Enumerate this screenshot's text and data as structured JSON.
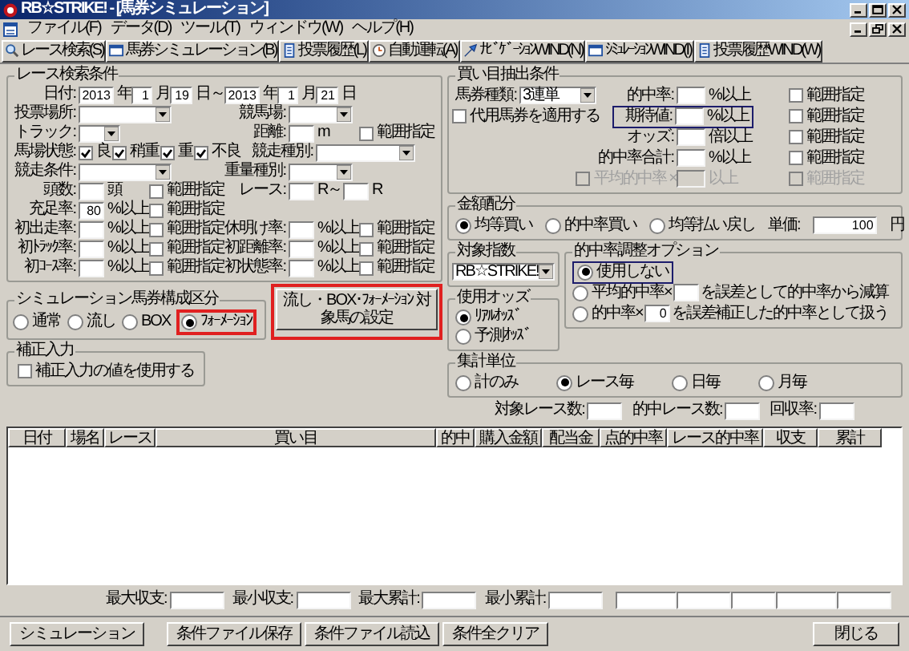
{
  "window": {
    "title": "RB☆STRIKE! - [馬券シミュレーション]"
  },
  "menu": [
    "ファイル(F)",
    "データ(D)",
    "ツール(T)",
    "ウィンドウ(W)",
    "ヘルプ(H)"
  ],
  "toolbar": [
    "レース検索(S)",
    "馬券シミュレーション(B)",
    "投票履歴(L)",
    "自動運転(A)",
    "ﾅﾋﾞｹﾞｰｼｮﾝWIND(N)",
    "ｼﾐｭﾚｰｼｮﾝWIND(I)",
    "投票履歴WIND(W)"
  ],
  "race_search": {
    "title": "レース検索条件",
    "lines": [
      {
        "items": [
          {
            "kind": "label",
            "text": "日付:"
          },
          {
            "kind": "field",
            "value": "2013"
          },
          {
            "kind": "unit",
            "text": "年"
          },
          {
            "kind": "field",
            "value": "1"
          },
          {
            "kind": "unit",
            "text": "月"
          },
          {
            "kind": "field",
            "value": "19"
          },
          {
            "kind": "unit",
            "text": "日～"
          },
          {
            "kind": "field",
            "value": "2013"
          },
          {
            "kind": "unit",
            "text": "年"
          },
          {
            "kind": "field",
            "value": "1"
          },
          {
            "kind": "unit",
            "text": "月"
          },
          {
            "kind": "field",
            "value": "21"
          },
          {
            "kind": "unit",
            "text": "日"
          }
        ]
      },
      {
        "items": [
          {
            "kind": "label",
            "text": "投票場所:"
          },
          {
            "kind": "dropdown"
          },
          {
            "kind": "label",
            "text": "競馬場:"
          },
          {
            "kind": "dropdown"
          }
        ]
      },
      {
        "items": [
          {
            "kind": "label",
            "text": "トラック:"
          },
          {
            "kind": "dropdown"
          },
          {
            "kind": "label",
            "text": "距離:"
          },
          {
            "kind": "field"
          },
          {
            "kind": "unit",
            "text": "m"
          },
          {
            "kind": "check",
            "text": "範囲指定",
            "checked": false
          }
        ]
      },
      {
        "items": [
          {
            "kind": "label",
            "text": "馬場状態:"
          },
          {
            "kind": "check",
            "text": "良",
            "checked": true
          },
          {
            "kind": "check",
            "text": "稍重",
            "checked": true
          },
          {
            "kind": "check",
            "text": "重",
            "checked": true
          },
          {
            "kind": "check",
            "text": "不良",
            "checked": true
          },
          {
            "kind": "label",
            "text": "競走種別:"
          },
          {
            "kind": "dropdown"
          }
        ]
      },
      {
        "items": [
          {
            "kind": "label",
            "text": "競走条件:"
          },
          {
            "kind": "dropdown"
          },
          {
            "kind": "label",
            "text": "重量種別:"
          },
          {
            "kind": "dropdown"
          }
        ]
      },
      {
        "items": [
          {
            "kind": "label",
            "text": "頭数:"
          },
          {
            "kind": "field"
          },
          {
            "kind": "unit",
            "text": "頭"
          },
          {
            "kind": "check",
            "text": "範囲指定",
            "checked": false
          },
          {
            "kind": "label",
            "text": "レース:"
          },
          {
            "kind": "field"
          },
          {
            "kind": "unit",
            "text": "R～"
          },
          {
            "kind": "field"
          },
          {
            "kind": "unit",
            "text": "R"
          }
        ]
      },
      {
        "items": [
          {
            "kind": "label",
            "text": "充足率:"
          },
          {
            "kind": "field",
            "value": "80"
          },
          {
            "kind": "unit",
            "text": "%以上"
          },
          {
            "kind": "check",
            "text": "範囲指定",
            "checked": false
          }
        ]
      },
      {
        "items": [
          {
            "kind": "label",
            "text": "初出走率:"
          },
          {
            "kind": "field"
          },
          {
            "kind": "unit",
            "text": "%以上"
          },
          {
            "kind": "check",
            "text": "範囲指定",
            "checked": false
          },
          {
            "kind": "label",
            "text": "休明け率:"
          },
          {
            "kind": "field"
          },
          {
            "kind": "unit",
            "text": "%以上"
          },
          {
            "kind": "check",
            "text": "範囲指定",
            "checked": false
          }
        ]
      },
      {
        "items": [
          {
            "kind": "label",
            "text": "初ﾄﾗｯｸ率:"
          },
          {
            "kind": "field"
          },
          {
            "kind": "unit",
            "text": "%以上"
          },
          {
            "kind": "check",
            "text": "範囲指定",
            "checked": false
          },
          {
            "kind": "label",
            "text": "初距離率:"
          },
          {
            "kind": "field"
          },
          {
            "kind": "unit",
            "text": "%以上"
          },
          {
            "kind": "check",
            "text": "範囲指定",
            "checked": false
          }
        ]
      },
      {
        "items": [
          {
            "kind": "label",
            "text": "初ｺｰｽ率:"
          },
          {
            "kind": "field"
          },
          {
            "kind": "unit",
            "text": "%以上"
          },
          {
            "kind": "check",
            "text": "範囲指定",
            "checked": false
          },
          {
            "kind": "label",
            "text": "初状態率:"
          },
          {
            "kind": "field"
          },
          {
            "kind": "unit",
            "text": "%以上"
          },
          {
            "kind": "check",
            "text": "範囲指定",
            "checked": false
          }
        ]
      }
    ]
  },
  "buy_conditions": {
    "title": "買い目抽出条件",
    "rows": [
      {
        "disabled": false,
        "items": [
          {
            "kind": "label",
            "text": "馬券種類:"
          },
          {
            "kind": "dropdown",
            "value": "3連単"
          },
          {
            "kind": "label",
            "text": "的中率:"
          },
          {
            "kind": "field"
          },
          {
            "kind": "unit",
            "text": "%以上"
          },
          {
            "kind": "check",
            "text": "範囲指定",
            "checked": false
          }
        ]
      },
      {
        "disabled": false,
        "items": [
          {
            "kind": "check",
            "text": "代用馬券を適用する",
            "checked": false
          },
          {
            "kind": "group",
            "color": "#1c1c6b",
            "items": [
              {
                "kind": "label",
                "text": "期待値:"
              },
              {
                "kind": "field"
              },
              {
                "kind": "unit",
                "text": "%以上"
              }
            ]
          },
          {
            "kind": "check",
            "text": "範囲指定",
            "checked": false
          }
        ]
      },
      {
        "disabled": false,
        "items": [
          {
            "kind": "label",
            "text": "オッズ:"
          },
          {
            "kind": "field"
          },
          {
            "kind": "unit",
            "text": "倍以上"
          },
          {
            "kind": "check",
            "text": "範囲指定",
            "checked": false
          }
        ]
      },
      {
        "disabled": false,
        "items": [
          {
            "kind": "label",
            "text": "的中率合計:"
          },
          {
            "kind": "field"
          },
          {
            "kind": "unit",
            "text": "%以上"
          },
          {
            "kind": "check",
            "text": "範囲指定",
            "checked": false
          }
        ]
      },
      {
        "disabled": true,
        "items": [
          {
            "kind": "check",
            "text": "平均的中率 ×",
            "checked": false
          },
          {
            "kind": "field"
          },
          {
            "kind": "unit",
            "text": "以上"
          },
          {
            "kind": "check",
            "text": "範囲指定",
            "checked": false
          }
        ]
      }
    ]
  },
  "amount_allocation": {
    "title": "金額配分",
    "options": [
      {
        "label": "均等買い",
        "selected": true
      },
      {
        "label": "的中率買い",
        "selected": false
      },
      {
        "label": "均等払い戻し",
        "selected": false
      }
    ],
    "unit_price": {
      "label": "単価:",
      "value": "100",
      "unit": "円"
    }
  },
  "target_index": {
    "title": "対象指数",
    "value": "RB☆STRIKE!"
  },
  "odds_used": {
    "title": "使用オッズ",
    "options": [
      {
        "label": "ﾘｱﾙｵｯｽﾞ",
        "selected": true
      },
      {
        "label": "予測ｵｯｽﾞ",
        "selected": false
      }
    ]
  },
  "hit_rate_adjustment": {
    "title": "的中率調整オプション",
    "options": [
      {
        "kind": "plain",
        "label": "使用しない",
        "selected": true,
        "color": "#1c1c6b"
      },
      {
        "kind": "field",
        "label": "平均的中率×",
        "suffix": "を誤差として的中率から減算",
        "selected": false
      },
      {
        "kind": "field",
        "label": "的中率×",
        "value": "0",
        "suffix": "を誤差補正した的中率として扱う",
        "selected": false
      }
    ]
  },
  "aggregation": {
    "title": "集計単位",
    "options": [
      {
        "label": "計のみ",
        "selected": false
      },
      {
        "label": "レース毎",
        "selected": true
      },
      {
        "label": "日毎",
        "selected": false
      },
      {
        "label": "月毎",
        "selected": false
      }
    ]
  },
  "race_counts": [
    "対象レース数:",
    "的中レース数:",
    "回収率:"
  ],
  "simulation_type": {
    "title": "シミュレーション馬券構成区分",
    "options": [
      {
        "label": "通常",
        "selected": false
      },
      {
        "label": "流し",
        "selected": false
      },
      {
        "label": "BOX",
        "selected": false
      },
      {
        "label": "ﾌｫｰﾒｰｼｮﾝ",
        "selected": true,
        "color": "#e02020"
      }
    ],
    "setup_button": {
      "label": "流し・BOX･ﾌｫｰﾒｰｼｮﾝ 対象馬の設定",
      "color": "#e02020"
    }
  },
  "correction": {
    "title": "補正入力",
    "label": "補正入力の値を使用する",
    "checked": false
  },
  "table": {
    "columns": [
      "日付",
      "場名",
      "レース",
      "買い目",
      "的中",
      "購入金額",
      "配当金",
      "点的中率",
      "レース的中率",
      "収支",
      "累計"
    ]
  },
  "summary": [
    "最大収支:",
    "最小収支:",
    "最大累計:",
    "最小累計:"
  ],
  "buttons": [
    "シミュレーション",
    "条件ファイル保存",
    "条件ファイル読込",
    "条件全クリア"
  ],
  "close_button": "閉じる"
}
